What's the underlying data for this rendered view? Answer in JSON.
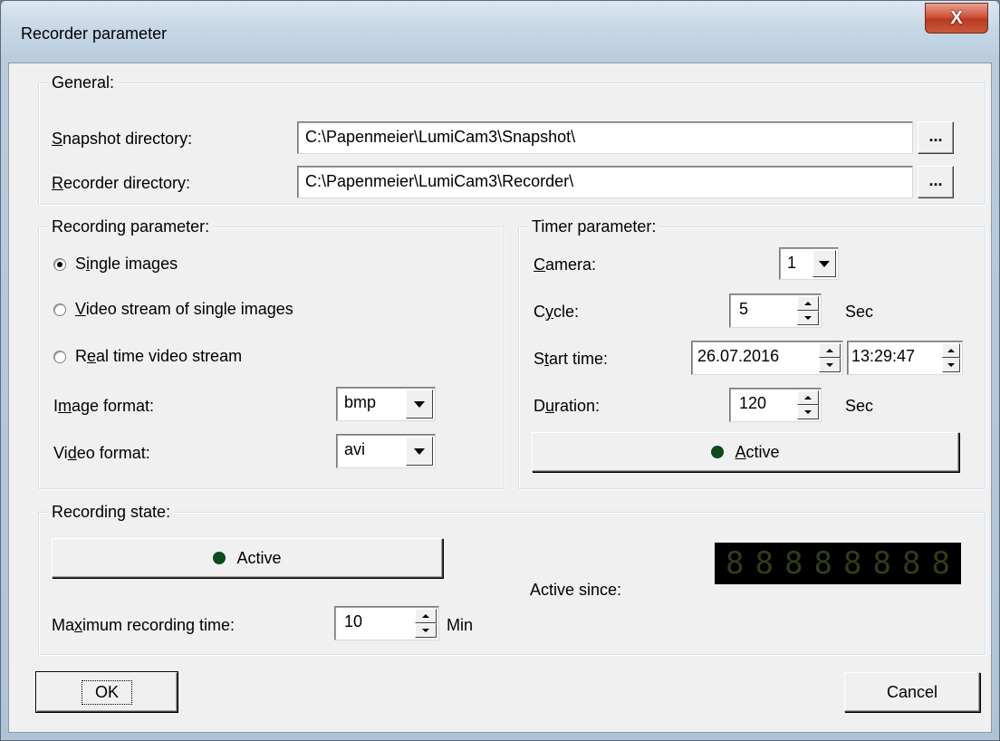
{
  "window": {
    "title": "Recorder parameter",
    "close_label": "X"
  },
  "general": {
    "title": "General:",
    "snapshot_label_u": "S",
    "snapshot_label_rest": "napshot directory:",
    "snapshot_value": "C:\\Papenmeier\\LumiCam3\\Snapshot\\",
    "recorder_label_u": "R",
    "recorder_label_rest": "ecorder directory:",
    "recorder_value": "C:\\Papenmeier\\LumiCam3\\Recorder\\",
    "browse_label": "..."
  },
  "recording": {
    "title": "Recording parameter:",
    "single_pre": "S",
    "single_u": "i",
    "single_rest": "ngle images",
    "videostream_u": "V",
    "videostream_rest": "ideo stream of single images",
    "realtime_pre": "R",
    "realtime_u": "e",
    "realtime_rest": "al time video stream",
    "image_format_pre": "I",
    "image_format_u": "m",
    "image_format_rest": "age format:",
    "image_format_value": "bmp",
    "video_format_pre": "Vi",
    "video_format_u": "d",
    "video_format_rest": "eo format:",
    "video_format_value": "avi",
    "selected": "single"
  },
  "timer": {
    "title": "Timer parameter:",
    "camera_u": "C",
    "camera_rest": "amera:",
    "camera_value": "1",
    "cycle_pre": "C",
    "cycle_u": "y",
    "cycle_rest": "cle:",
    "cycle_value": "5",
    "cycle_unit": "Sec",
    "start_pre": "S",
    "start_u": "t",
    "start_rest": "art time:",
    "start_date": "26.07.2016",
    "start_time": "13:29:47",
    "duration_pre": "D",
    "duration_u": "u",
    "duration_rest": "ration:",
    "duration_value": "120",
    "duration_unit": "Sec",
    "active_u": "A",
    "active_rest": "ctive"
  },
  "state": {
    "title": "Recording state:",
    "active_label": "Active",
    "active_since_label": "Active since:",
    "digits": [
      "8",
      "8",
      "8",
      "8",
      "8",
      "8",
      "8",
      "8"
    ],
    "max_pre": "Ma",
    "max_u": "x",
    "max_rest": "imum recording time:",
    "max_value": "10",
    "max_unit": "Min"
  },
  "buttons": {
    "ok": "OK",
    "cancel": "Cancel"
  },
  "colors": {
    "led": "#0c4a1c",
    "digit_dim": "#2f3d1a",
    "close": "#c9593c"
  }
}
